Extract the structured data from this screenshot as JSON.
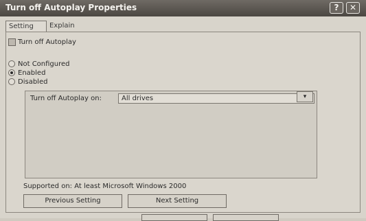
{
  "window": {
    "title": "Turn off Autoplay Properties",
    "help_glyph": "?",
    "close_glyph": "✕"
  },
  "tabs": [
    {
      "label": "Setting"
    },
    {
      "label": "Explain"
    }
  ],
  "policy": {
    "name": "Turn off Autoplay",
    "icon": "policy-icon"
  },
  "state": {
    "options": [
      {
        "label": "Not Configured",
        "checked": false
      },
      {
        "label": "Enabled",
        "checked": true
      },
      {
        "label": "Disabled",
        "checked": false
      }
    ]
  },
  "autoplay": {
    "label": "Turn off Autoplay on:",
    "selected": "All drives",
    "dropdown_glyph": "▾"
  },
  "supported": "Supported on:   At least Microsoft Windows 2000",
  "buttons": {
    "previous": "Previous Setting",
    "next": "Next Setting"
  }
}
